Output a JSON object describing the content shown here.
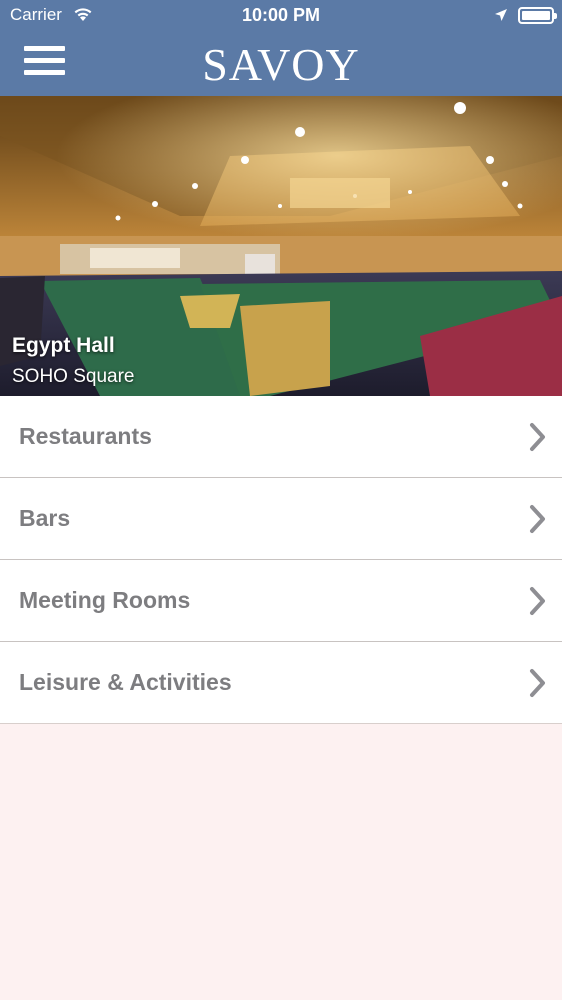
{
  "status_bar": {
    "carrier": "Carrier",
    "time": "10:00 PM",
    "wifi_icon": "wifi-icon",
    "location_icon": "location-arrow-icon",
    "battery_icon": "battery-icon"
  },
  "header": {
    "title": "SAVOY",
    "menu_icon": "hamburger-menu-icon",
    "background_color": "#5b7aa6"
  },
  "hero": {
    "title": "Egypt Hall",
    "subtitle": "SOHO Square"
  },
  "menu_items": [
    {
      "label": "Restaurants",
      "icon": "chevron-right-icon"
    },
    {
      "label": "Bars",
      "icon": "chevron-right-icon"
    },
    {
      "label": "Meeting Rooms",
      "icon": "chevron-right-icon"
    },
    {
      "label": "Leisure & Activities",
      "icon": "chevron-right-icon"
    }
  ],
  "colors": {
    "page_background": "#fdf1f1",
    "label_text": "#7d7d80",
    "chevron": "#8e8e93"
  }
}
